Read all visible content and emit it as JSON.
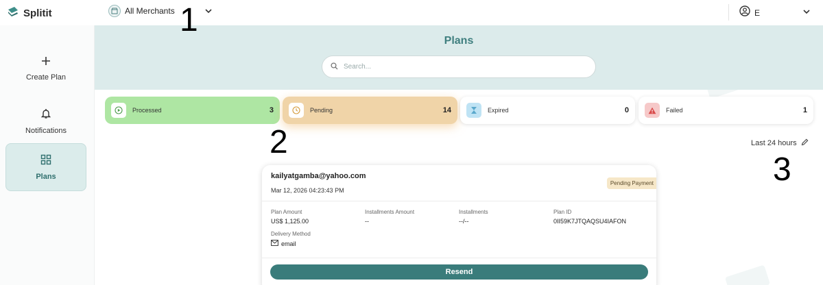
{
  "brand": {
    "name": "Splitit"
  },
  "header": {
    "merchant_label": "All Merchants",
    "user_label": "E"
  },
  "sidebar": {
    "items": [
      {
        "label": "Create Plan",
        "icon": "plus-icon"
      },
      {
        "label": "Notifications",
        "icon": "bell-icon"
      },
      {
        "label": "Plans",
        "icon": "grid-icon",
        "active": true
      }
    ]
  },
  "main": {
    "title": "Plans",
    "search": {
      "placeholder": "Search...",
      "value": ""
    },
    "stats": [
      {
        "label": "Processed",
        "count": "3",
        "icon": "play-circle-icon",
        "color": "#aee6a3"
      },
      {
        "label": "Pending",
        "count": "14",
        "icon": "clock-icon",
        "color": "#f0d4a8"
      },
      {
        "label": "Expired",
        "count": "0",
        "icon": "hourglass-icon",
        "color": "#ffffff"
      },
      {
        "label": "Failed",
        "count": "1",
        "icon": "warning-icon",
        "color": "#ffffff"
      }
    ],
    "timeframe": "Last 24 hours",
    "annotations": [
      "1",
      "2",
      "3"
    ],
    "plan": {
      "email": "kailyatgamba@yahoo.com",
      "date": "Mar 12, 2026 04:23:43 PM",
      "status": "Pending Payment",
      "fields": {
        "plan_amount_label": "Plan Amount",
        "plan_amount_value": "US$ 1,125.00",
        "installments_amount_label": "Installments Amount",
        "installments_amount_value": "--",
        "installments_label": "Installments",
        "installments_value": "--/--",
        "plan_id_label": "Plan ID",
        "plan_id_value": "0II59K7JTQAQSU4IAFON",
        "delivery_label": "Delivery Method",
        "delivery_value": "email"
      },
      "resend_label": "Resend"
    }
  },
  "colors": {
    "accent": "#3a7c7b",
    "band": "#dcebeb",
    "title": "#3f7f7f"
  }
}
